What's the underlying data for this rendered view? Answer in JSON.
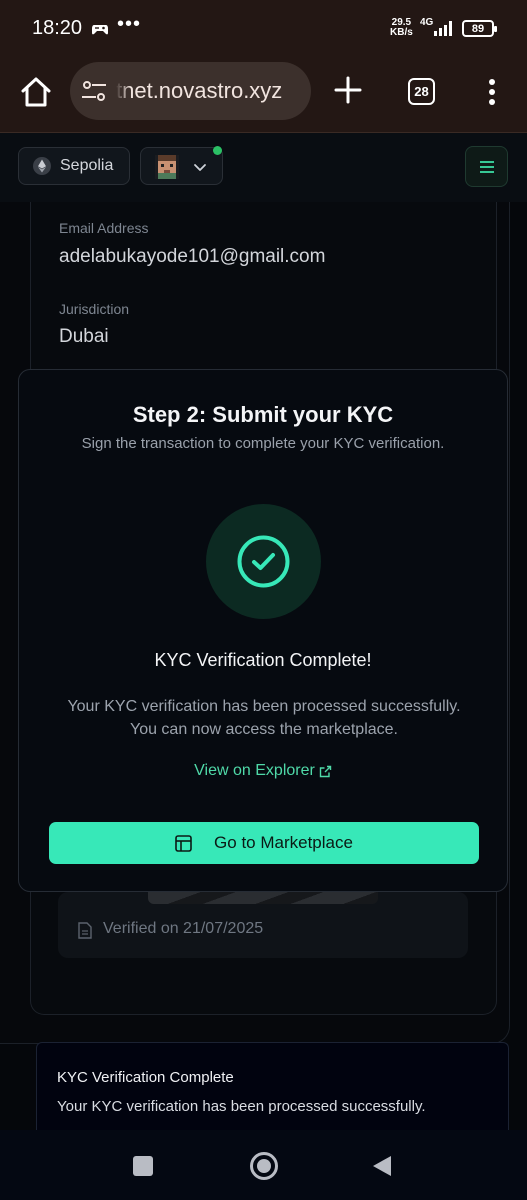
{
  "status_bar": {
    "time": "18:20",
    "dots": "•••",
    "speed_value": "29.5",
    "speed_unit": "KB/s",
    "network_type": "4G",
    "battery": "89"
  },
  "browser": {
    "url": "tnet.novastro.xyz",
    "tab_count": "28"
  },
  "header": {
    "network_label": "Sepolia"
  },
  "profile": {
    "email_label": "Email Address",
    "email_value": "adelabukayode101@gmail.com",
    "jurisdiction_label": "Jurisdiction",
    "jurisdiction_value": "Dubai",
    "verified_text": "Verified on 21/07/2025"
  },
  "modal": {
    "title": "Step 2: Submit your KYC",
    "subtitle": "Sign the transaction to complete your KYC verification.",
    "complete_title": "KYC Verification Complete!",
    "complete_desc": "Your KYC verification has been processed successfully. You can now access the marketplace.",
    "explorer_link": "View on Explorer",
    "marketplace_button": "Go to Marketplace"
  },
  "toast": {
    "title": "KYC Verification Complete",
    "description": "Your KYC verification has been processed successfully."
  },
  "colors": {
    "accent": "#37e8b8",
    "link": "#4fd9a8",
    "online": "#2bc065"
  }
}
